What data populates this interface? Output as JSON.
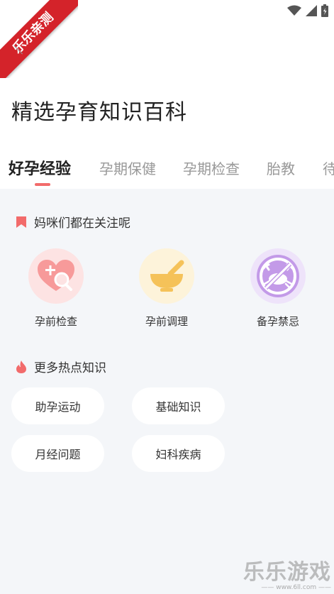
{
  "watermark": {
    "ribbon_text": "乐乐亲测",
    "brand_text": "乐乐游戏",
    "brand_url": "—— www.6ll.com ——"
  },
  "page": {
    "title": "精选孕育知识百科"
  },
  "tabs": [
    {
      "label": "好孕经验",
      "active": true
    },
    {
      "label": "孕期保健",
      "active": false
    },
    {
      "label": "孕期检查",
      "active": false
    },
    {
      "label": "胎教",
      "active": false
    },
    {
      "label": "待",
      "active": false
    }
  ],
  "popular": {
    "title": "妈咪们都在关注呢",
    "items": [
      {
        "label": "孕前检查",
        "icon": "heart-magnifier-icon"
      },
      {
        "label": "孕前调理",
        "icon": "mortar-pestle-icon"
      },
      {
        "label": "备孕禁忌",
        "icon": "no-crab-icon"
      }
    ]
  },
  "more": {
    "title": "更多热点知识",
    "items": [
      "助孕运动",
      "基础知识",
      "月经问题",
      "妇科疾病"
    ]
  },
  "colors": {
    "accent": "#f26b6b",
    "background": "#f4f6f9",
    "ribbon": "#d4232a"
  }
}
